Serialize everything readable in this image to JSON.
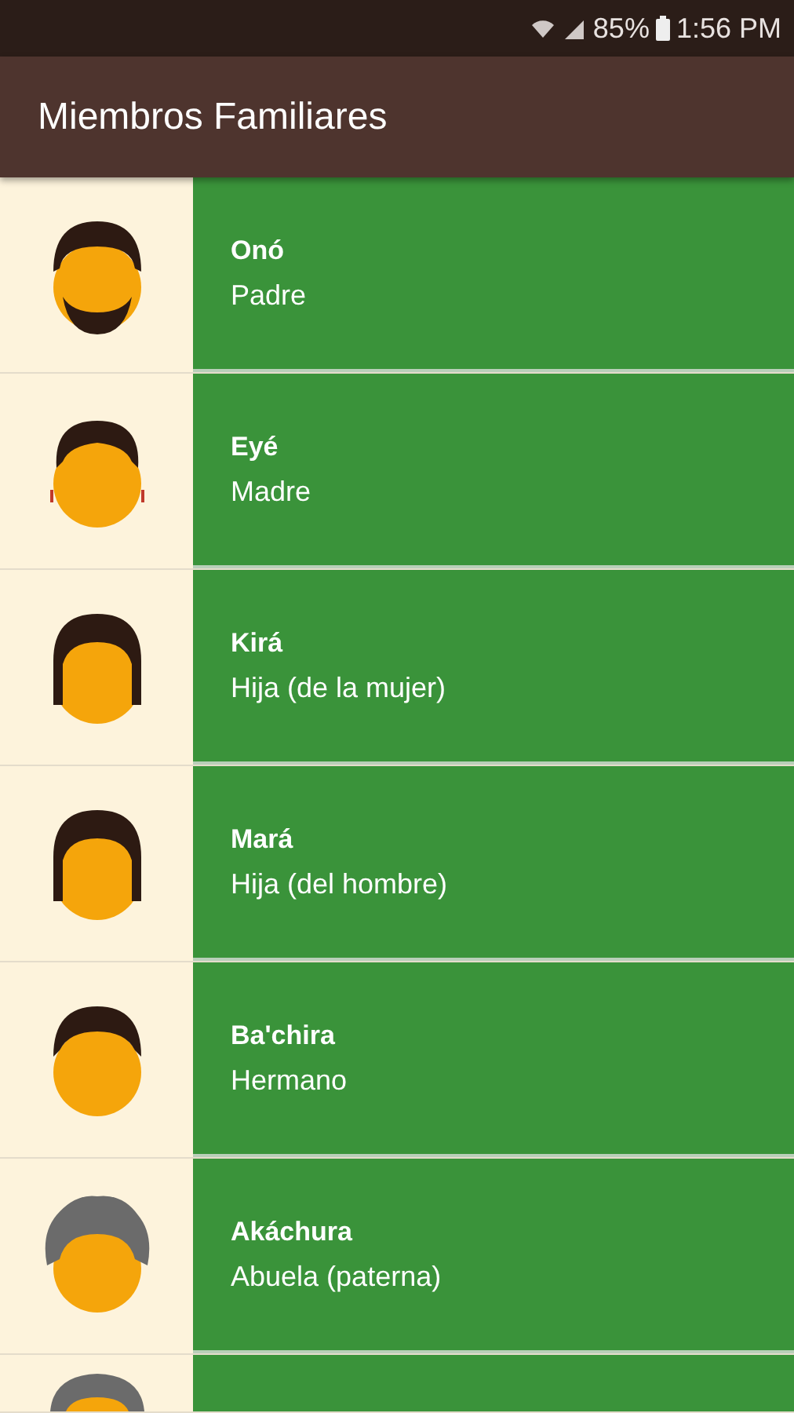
{
  "status_bar": {
    "battery": "85%",
    "time": "1:56 PM"
  },
  "app_bar": {
    "title": "Miembros Familiares"
  },
  "members": [
    {
      "kind": "bearded-man",
      "name": "Onó",
      "relation": "Padre"
    },
    {
      "kind": "woman",
      "name": "Eyé",
      "relation": "Madre"
    },
    {
      "kind": "girl",
      "name": "Kirá",
      "relation": "Hija (de la mujer)"
    },
    {
      "kind": "girl",
      "name": "Mará",
      "relation": "Hija (del hombre)"
    },
    {
      "kind": "boy",
      "name": "Ba'chira",
      "relation": "Hermano"
    },
    {
      "kind": "elder",
      "name": "Akáchura",
      "relation": "Abuela (paterna)"
    },
    {
      "kind": "elder"
    }
  ]
}
